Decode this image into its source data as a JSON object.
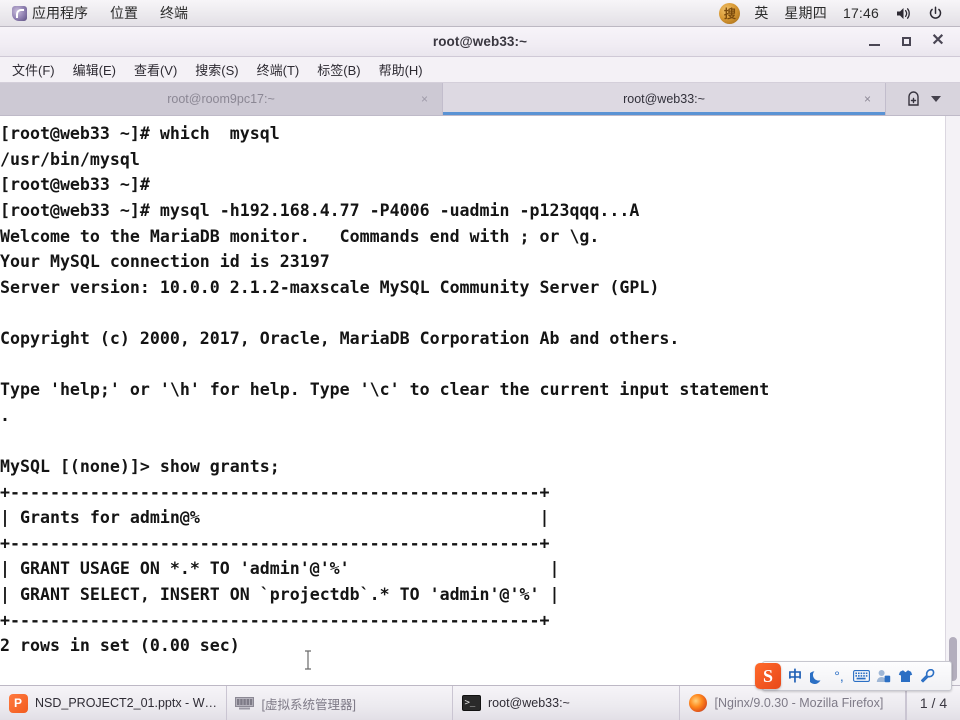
{
  "top_panel": {
    "menus": [
      {
        "label": "应用程序",
        "icon": "fedora-logo-icon"
      },
      {
        "label": "位置",
        "icon": null
      },
      {
        "label": "终端",
        "icon": null
      }
    ],
    "tray": {
      "input_method_icon": "sogou-ime-icon",
      "input_mode": "英",
      "weekday": "星期四",
      "time": "17:46",
      "volume_icon": "volume-icon",
      "power_icon": "power-icon"
    }
  },
  "window": {
    "title": "root@web33:~",
    "buttons": {
      "minimize": "minimize-icon",
      "maximize": "maximize-icon",
      "close": "close-icon"
    },
    "menubar": [
      "文件(F)",
      "编辑(E)",
      "查看(V)",
      "搜索(S)",
      "终端(T)",
      "标签(B)",
      "帮助(H)"
    ],
    "tabs": [
      {
        "label": "root@room9pc17:~",
        "active": false,
        "close": "×"
      },
      {
        "label": "root@web33:~",
        "active": true,
        "close": "×"
      }
    ],
    "tab_tools": {
      "new_tab_icon": "new-tab-icon",
      "menu_icon": "chevron-down-icon"
    }
  },
  "terminal": {
    "lines": [
      "[root@web33 ~]# which  mysql",
      "/usr/bin/mysql",
      "[root@web33 ~]#",
      "[root@web33 ~]# mysql -h192.168.4.77 -P4006 -uadmin -p123qqq...A",
      "Welcome to the MariaDB monitor.   Commands end with ; or \\g.",
      "Your MySQL connection id is 23197",
      "Server version: 10.0.0 2.1.2-maxscale MySQL Community Server (GPL)",
      "",
      "Copyright (c) 2000, 2017, Oracle, MariaDB Corporation Ab and others.",
      "",
      "Type 'help;' or '\\h' for help. Type '\\c' to clear the current input statement",
      ".",
      "",
      "MySQL [(none)]> show grants;",
      "+-----------------------------------------------------+",
      "| Grants for admin@%                                  |",
      "+-----------------------------------------------------+",
      "| GRANT USAGE ON *.* TO 'admin'@'%'                    |",
      "| GRANT SELECT, INSERT ON `projectdb`.* TO 'admin'@'%' |",
      "+-----------------------------------------------------+",
      "2 rows in set (0.00 sec)",
      ""
    ],
    "prompt": "MySQL [(none)]> ",
    "cursor": "block-cursor",
    "scrollbar": "terminal-scrollbar",
    "mouse_cursor": "i-beam-cursor"
  },
  "sogou_bar": {
    "logo": "sogou-logo-icon",
    "items": [
      {
        "icon": "chinese-mode-icon",
        "glyph": "中"
      },
      {
        "icon": "moon-icon",
        "glyph": "☽"
      },
      {
        "icon": "punctuation-icon",
        "glyph": "°,"
      },
      {
        "icon": "keyboard-icon",
        "glyph": "⌨"
      },
      {
        "icon": "user-icon",
        "glyph": "◓"
      },
      {
        "icon": "skin-icon",
        "glyph": "👕"
      },
      {
        "icon": "settings-wrench-icon",
        "glyph": "🔧"
      }
    ]
  },
  "taskbar": {
    "tasks": [
      {
        "label": "NSD_PROJECT2_01.pptx - WP…",
        "icon": "wps-presentation-icon",
        "active": false
      },
      {
        "label": "[虚拟系统管理器]",
        "icon": "virtual-machine-manager-icon",
        "active": false
      },
      {
        "label": "root@web33:~",
        "icon": "terminal-icon",
        "active": true
      },
      {
        "label": "[Nginx/9.0.30 - Mozilla Firefox]",
        "icon": "firefox-icon",
        "active": false
      }
    ],
    "pager": "1 / 4"
  },
  "colors": {
    "panel_bg": "#eceaee",
    "window_bg": "#f2eff4",
    "tab_active_bg": "#ddd9e2",
    "tab_inactive_bg": "#cdc9d4",
    "tab_accent": "#5a93d4",
    "terminal_bg": "#ffffff",
    "terminal_fg": "#141414",
    "sogou_orange": "#e8481a"
  }
}
